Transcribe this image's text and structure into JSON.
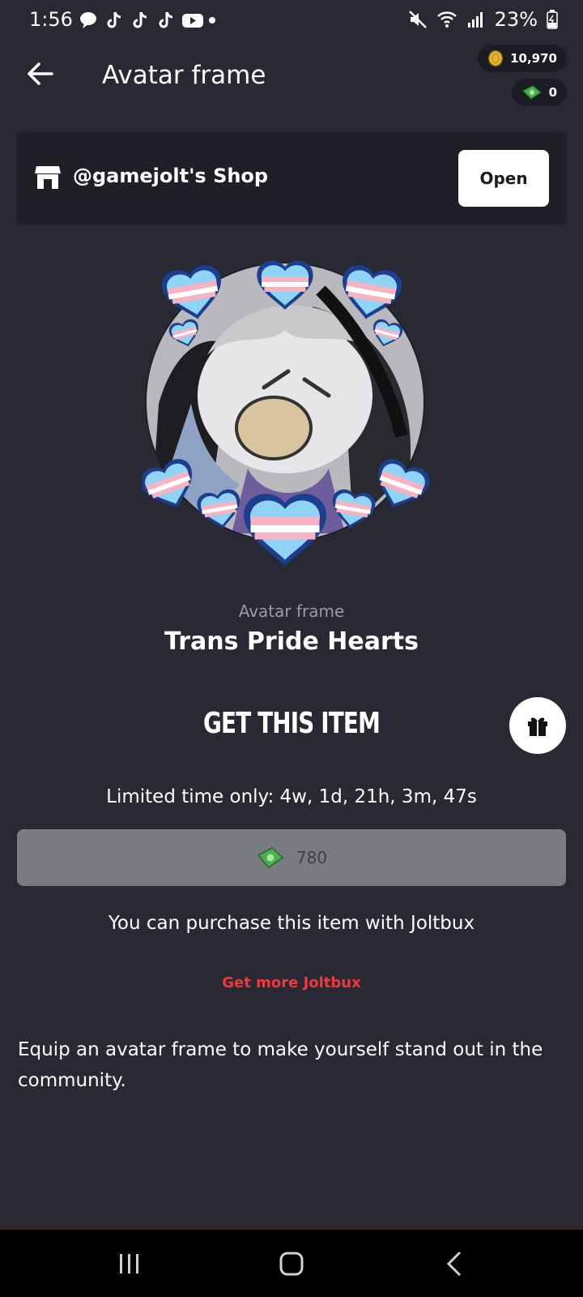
{
  "status_bar": {
    "time": "1:56",
    "battery": "23%"
  },
  "header": {
    "title": "Avatar frame"
  },
  "wallet": {
    "coins": "10,970",
    "joltbux": "0"
  },
  "shop": {
    "name": "@gamejolt's Shop",
    "open_label": "Open"
  },
  "item": {
    "type": "Avatar frame",
    "name": "Trans Pride Hearts"
  },
  "purchase": {
    "section_title": "GET THIS ITEM",
    "limited_text": "Limited time only: 4w, 1d, 21h, 3m, 47s",
    "price": "780",
    "note": "You can purchase this item with Joltbux",
    "get_more_label": "Get more Joltbux"
  },
  "description": "Equip an avatar frame to make yourself stand out in the community.",
  "colors": {
    "background": "#282932",
    "card": "#1f2027",
    "accent_red": "#f0383d",
    "price_button": "#7a7b80",
    "trans_blue": "#5bcefa",
    "trans_pink": "#f5a9b8"
  }
}
